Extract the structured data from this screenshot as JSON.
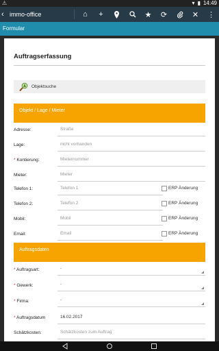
{
  "status": {
    "time": "14:49"
  },
  "app": {
    "title": "immo-office"
  },
  "nav": {
    "label": "Formular"
  },
  "form": {
    "title": "Auftragserfassung",
    "objektsuche_label": "Objektsuche",
    "section1": "Objekt / Lage / Mieter",
    "section2": "Auftragsdaten",
    "rows1": [
      {
        "label": "Adresse:",
        "placeholder": "Straße"
      },
      {
        "label": "Lage:",
        "placeholder": "nicht vorhanden"
      },
      {
        "label": "Kontierung:",
        "required": true,
        "placeholder": "Mieternummer"
      },
      {
        "label": "Mieter:",
        "placeholder": "Mieter"
      },
      {
        "label": "Telefon 1:",
        "placeholder": "Telefon 1",
        "erp": "ERP Änderung"
      },
      {
        "label": "Telefon 2:",
        "placeholder": "Telefon 2",
        "erp": "ERP Änderung"
      },
      {
        "label": "Mobil:",
        "placeholder": "Mobil",
        "erp": "ERP Änderung"
      },
      {
        "label": "Email:",
        "placeholder": "Email",
        "erp": "ERP Änderung"
      }
    ],
    "rows2": [
      {
        "label": "Auftragsart:",
        "required": true,
        "select": "-"
      },
      {
        "label": "Gewerk:",
        "required": true,
        "select": "-"
      },
      {
        "label": "Firma:",
        "required": true,
        "select": "-"
      },
      {
        "label": "Auftragsdatum",
        "required": true,
        "value": "16.02.2017"
      },
      {
        "label": "Schätzkosten:",
        "placeholder": "Schätzkosten zum Auftrag"
      }
    ]
  }
}
